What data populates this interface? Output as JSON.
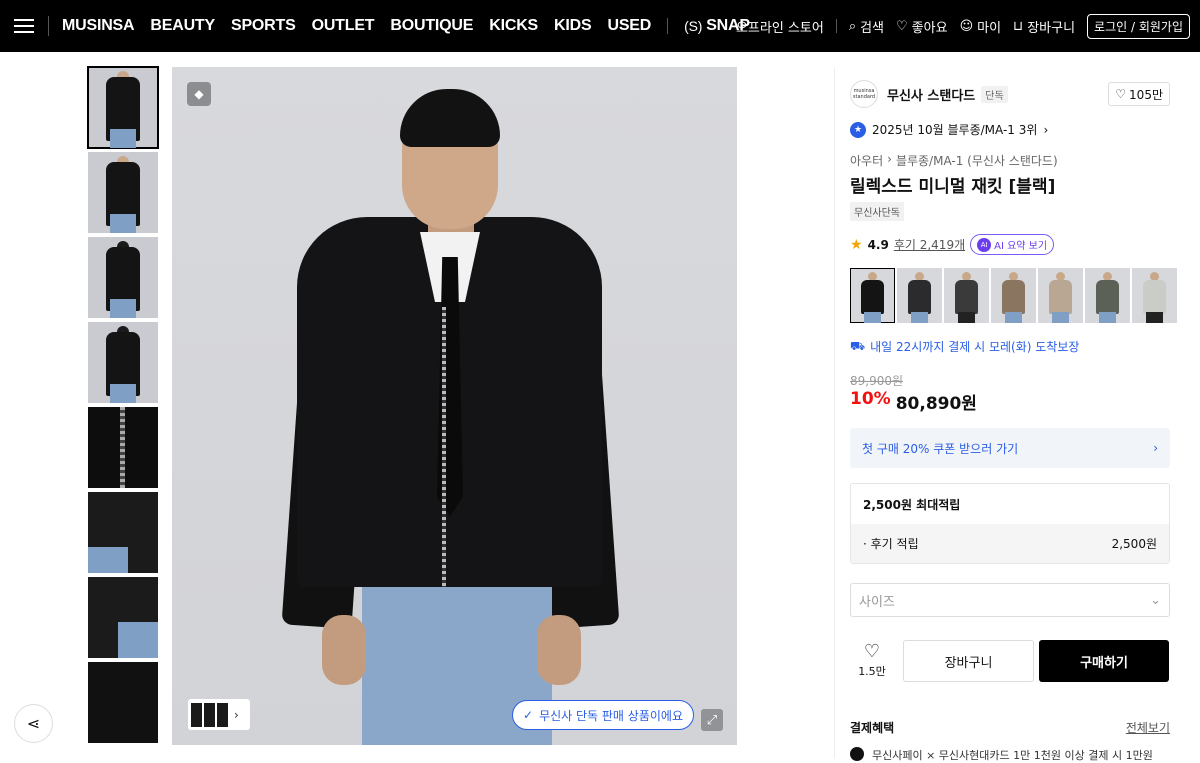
{
  "nav": {
    "links": [
      "MUSINSA",
      "BEAUTY",
      "SPORTS",
      "OUTLET",
      "BOUTIQUE",
      "KICKS",
      "KIDS",
      "USED"
    ],
    "snap_prefix": "(S)",
    "snap_label": "SNAP",
    "offline_store": "오프라인 스토어",
    "search": "검색",
    "likes": "좋아요",
    "my": "마이",
    "cart": "장바구니",
    "login": "로그인 / 회원가입"
  },
  "gallery": {
    "exclusive_pill": "무신사 단독 판매 상품이에요"
  },
  "product": {
    "brand_name": "무신사 스탠다드",
    "brand_logo_text": "musinsa standard",
    "brand_tag": "단독",
    "like_count": "105만",
    "rank_text": "2025년 10월 블루종/MA-1 3위",
    "breadcrumb": [
      "아우터",
      "블루종/MA-1 (무신사 스탠다드)"
    ],
    "title": "릴렉스드 미니멀 재킷 [블랙]",
    "exclusive_badge": "무신사단독",
    "rating": "4.9",
    "review_text": "후기 2,419개",
    "ai_label": "AI 요약 보기",
    "ai_badge": "AI",
    "delivery": "내일 22시까지 결제 시 모레(화) 도착보장",
    "original_price": "89,900원",
    "discount": "10%",
    "price": "80,890원",
    "coupon": "첫 구매 20% 쿠폰 받으러 가기",
    "points_title": "2,500원 최대적립",
    "points_review_label": "· 후기 적립",
    "points_review_value": "2,500원",
    "size_placeholder": "사이즈",
    "wish_count": "1.5만",
    "cart_button": "장바구니",
    "buy_button": "구매하기",
    "benefits_title": "결제혜택",
    "benefits_all": "전체보기",
    "payment_line": "무신사페이 × 무신사현대카드 1만 1천원 이상 결제 시 1만원"
  },
  "colors": {
    "accent_blue": "#2a5ee6",
    "discount_red": "#f31110",
    "black": "#000000"
  }
}
